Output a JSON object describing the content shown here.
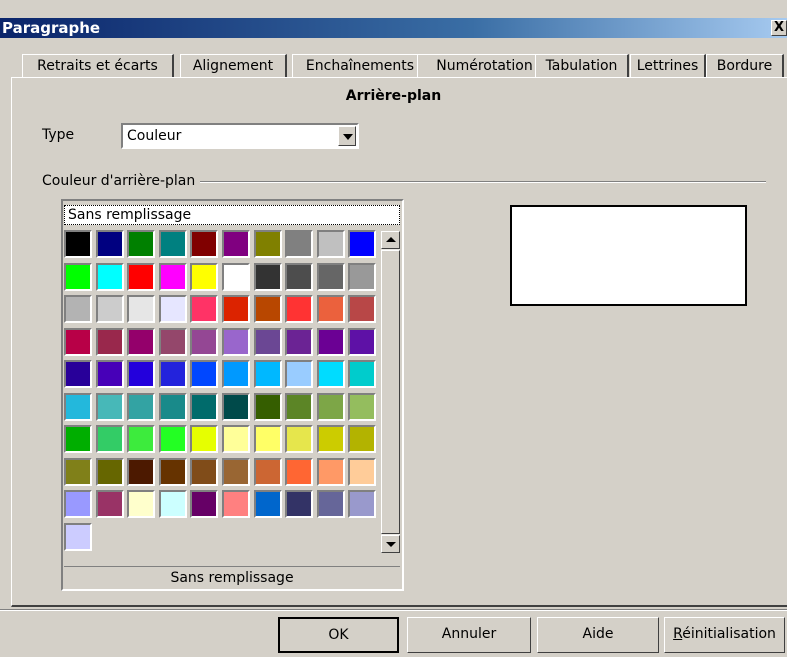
{
  "window": {
    "title": "Paragraphe",
    "close_label": "X"
  },
  "tabs": [
    {
      "label": "Retraits et écarts"
    },
    {
      "label": "Alignement"
    },
    {
      "label": "Enchaînements"
    },
    {
      "label": "Numérotation"
    },
    {
      "label": "Tabulation"
    },
    {
      "label": "Lettrines"
    },
    {
      "label": "Bordure"
    }
  ],
  "page": {
    "heading": "Arrière-plan",
    "type_label": "Type",
    "type_value": "Couleur",
    "group_label": "Couleur d'arrière-plan",
    "no_fill_label": "Sans remplissage",
    "selected_caption": "Sans remplissage"
  },
  "palette": [
    "#000000",
    "#000080",
    "#008000",
    "#008080",
    "#800000",
    "#800080",
    "#808000",
    "#808080",
    "#c0c0c0",
    "#0000ff",
    "#00ff00",
    "#00ffff",
    "#ff0000",
    "#ff00ff",
    "#ffff00",
    "#ffffff",
    "#333333",
    "#4d4d4d",
    "#666666",
    "#999999",
    "#b3b3b3",
    "#cccccc",
    "#e6e6e6",
    "#e6e6ff",
    "#ff3366",
    "#dc2300",
    "#b84700",
    "#ff3333",
    "#eb613d",
    "#b84747",
    "#b80047",
    "#99284c",
    "#94006b",
    "#94476b",
    "#944794",
    "#9966cc",
    "#6b4794",
    "#6b2394",
    "#6b0094",
    "#5e11a6",
    "#280099",
    "#4700b8",
    "#2300dc",
    "#2323dc",
    "#0047ff",
    "#0099ff",
    "#00b8ff",
    "#99ccff",
    "#00dcff",
    "#00cccc",
    "#23b8dc",
    "#47b8b8",
    "#33a3a3",
    "#198a8a",
    "#006b6b",
    "#004a4a",
    "#355e00",
    "#5c8526",
    "#7da647",
    "#94bd5e",
    "#00ae00",
    "#33cc66",
    "#3deb3d",
    "#23ff23",
    "#e6ff00",
    "#ffff99",
    "#ffff66",
    "#e6e64c",
    "#cccc00",
    "#b3b300",
    "#808019",
    "#666600",
    "#4c1900",
    "#663300",
    "#804c19",
    "#996633",
    "#cc6633",
    "#ff6633",
    "#ff9966",
    "#ffcc99",
    "#9999ff",
    "#993366",
    "#ffffcc",
    "#ccffff",
    "#660066",
    "#ff8080",
    "#0066cc",
    "#333366",
    "#666699",
    "#9999cc",
    "#ccccff"
  ],
  "buttons": {
    "ok": "OK",
    "cancel": "Annuler",
    "help": "Aide",
    "reset_first": "R",
    "reset_rest": "éinitialisation"
  }
}
